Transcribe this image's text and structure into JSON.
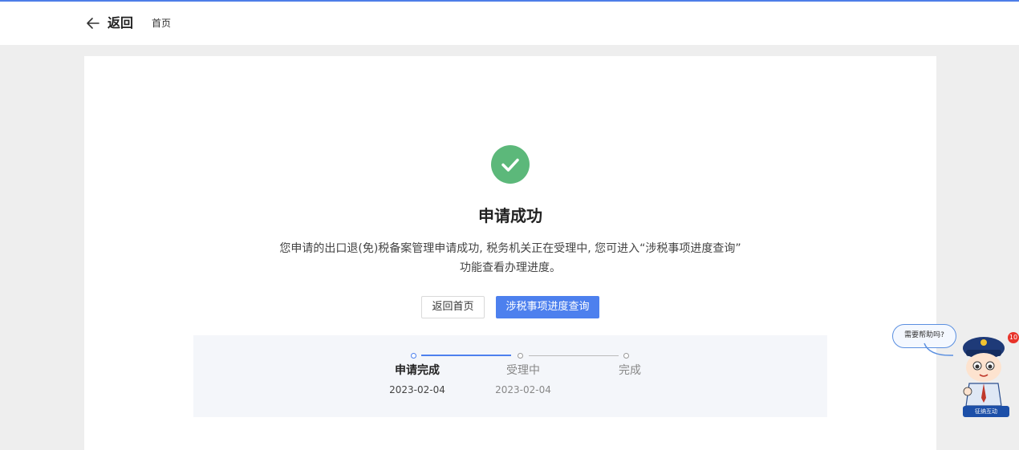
{
  "header": {
    "back_label": "返回",
    "home_link": "首页"
  },
  "result": {
    "title": "申请成功",
    "description_line1": "您申请的出口退(免)税备案管理申请成功, 税务机关正在受理中, 您可进入“涉税事项进度查询”",
    "description_line2": "功能查看办理进度。",
    "status_color": "#5cb87a"
  },
  "actions": {
    "home_button": "返回首页",
    "query_button": "涉税事项进度查询",
    "accent_color": "#4d80ee"
  },
  "steps": [
    {
      "label": "申请完成",
      "date": "2023-02-04",
      "state": "done"
    },
    {
      "label": "受理中",
      "date": "2023-02-04",
      "state": "pending"
    },
    {
      "label": "完成",
      "date": "",
      "state": "pending"
    }
  ],
  "help": {
    "bubble_text": "需要帮助吗?",
    "badge_count": "10",
    "mascot_label": "征纳互动"
  }
}
